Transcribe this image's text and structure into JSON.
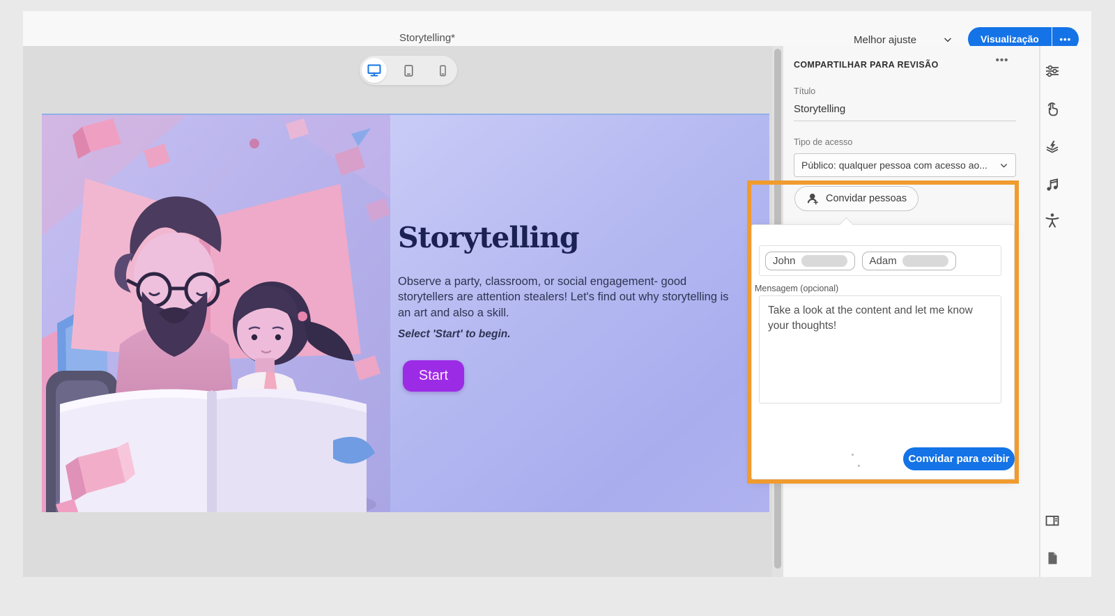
{
  "window": {
    "doc_title": "Storytelling*"
  },
  "top_bar": {
    "zoom_label": "Melhor ajuste",
    "preview_label": "Visualização",
    "more_label": "•••"
  },
  "device_toggle": {
    "icons": [
      "desktop",
      "tablet",
      "phone"
    ],
    "active": "desktop"
  },
  "slide": {
    "title": "Storytelling",
    "body_lines": [
      "Observe a party, classroom, or social engagement- good",
      "storytellers are attention stealers! Let's find out why storytelling is",
      "an art and also a skill."
    ],
    "instruction": "Select 'Start' to begin.",
    "start_label": "Start"
  },
  "share_panel": {
    "header": "COMPARTILHAR PARA REVISÃO",
    "more_label": "•••",
    "title_label": "Título",
    "title_value": "Storytelling",
    "access_label": "Tipo de acesso",
    "access_value": "Público: qualquer pessoa com acesso ao...",
    "invite_button": "Convidar pessoas",
    "popup": {
      "chips": [
        "John",
        "Adam"
      ],
      "message_label": "Mensagem (opcional)",
      "message_value": "Take a look at the content and let me know your thoughts!",
      "submit_button": "Convidar para exibir"
    }
  },
  "icon_rail": {
    "items": [
      "sliders-icon",
      "interaction-hand-icon",
      "effects-icon",
      "audio-icon",
      "accessibility-icon",
      "layout-icon",
      "document-icon"
    ]
  },
  "colors": {
    "accent_blue": "#1473E6",
    "highlight_orange": "#F09B2E",
    "start_purple": "#9C2BE6",
    "slide_lavender": "#B4B8EF"
  }
}
